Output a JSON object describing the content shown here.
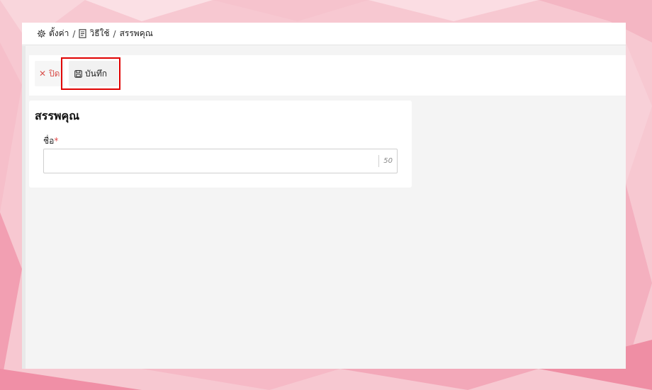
{
  "breadcrumb": {
    "settings_label": "ตั้งค่า",
    "separator": "/",
    "guide_label": "วิธีใช้",
    "current_label": "สรรพคุณ"
  },
  "toolbar": {
    "close_label": "ปิด",
    "save_label": "บันทึก"
  },
  "form": {
    "title": "สรรพคุณ",
    "name_label": "ชื่อ",
    "required_mark": "*",
    "name_value": "",
    "name_max_length": "50"
  },
  "colors": {
    "close_color": "#d9534f",
    "required_color": "#e24b4b",
    "highlight_border": "#e00000"
  }
}
